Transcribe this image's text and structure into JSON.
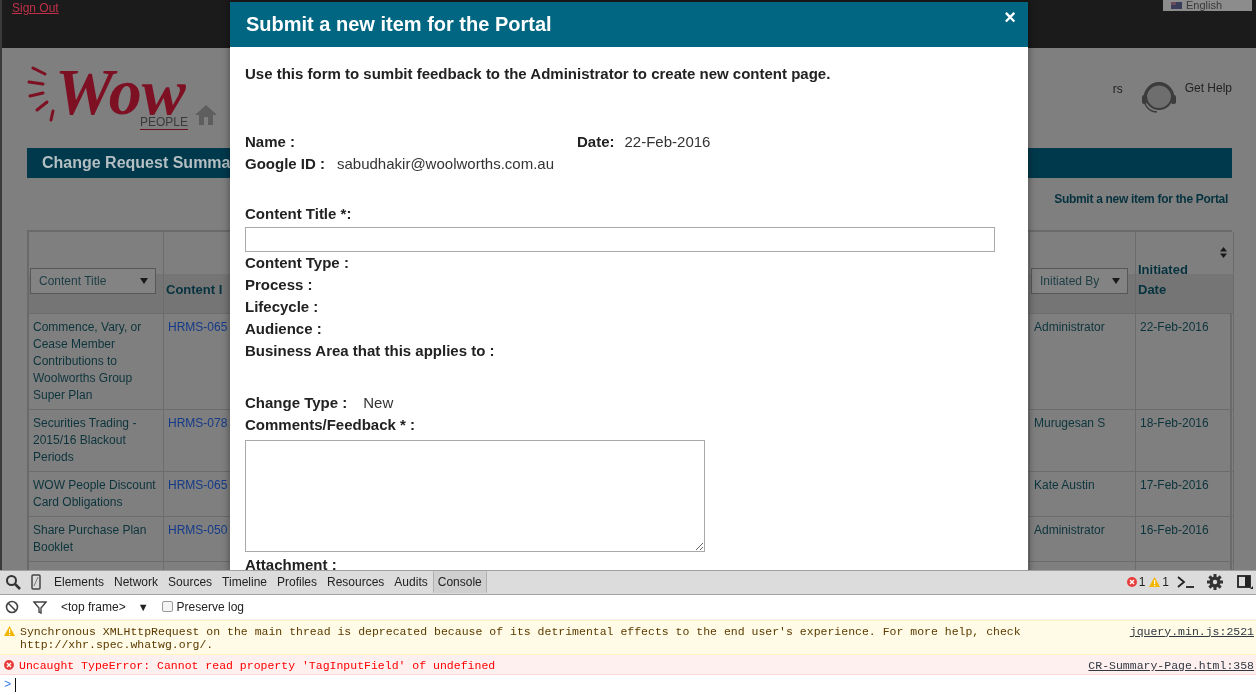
{
  "top_bar": {
    "sign_out": "Sign Out",
    "language": "English"
  },
  "header": {
    "logo_text": "Wow",
    "logo_subtext": "PEOPLE",
    "nav_partial": "rs",
    "help": "Get Help"
  },
  "banner": {
    "title": "Change Request Summa"
  },
  "submit_link": "Submit a new item for the Portal",
  "table": {
    "columns": [
      {
        "kind": "filter",
        "label": "Content Title"
      },
      {
        "kind": "heading",
        "label": "Content I"
      },
      {
        "kind": "filter",
        "label": "Initiated By"
      },
      {
        "kind": "sortable",
        "label": "Initiated Date"
      }
    ],
    "rows": [
      {
        "content_title": "Commence, Vary, or Cease Member Contributions to Woolworths Group Super Plan",
        "content_id": "HRMS-065",
        "initiated_by": "Administrator",
        "initiated_date": "22-Feb-2016"
      },
      {
        "content_title": "Securities Trading - 2015/16 Blackout Periods",
        "content_id": "HRMS-078",
        "initiated_by": "Murugesan S",
        "initiated_date": "18-Feb-2016"
      },
      {
        "content_title": "WOW People Discount Card Obligations",
        "content_id": "HRMS-065",
        "initiated_by": "Kate Austin",
        "initiated_date": "17-Feb-2016"
      },
      {
        "content_title": "Share Purchase Plan Booklet",
        "content_id": "HRMS-050",
        "initiated_by": "Administrator",
        "initiated_date": "16-Feb-2016"
      }
    ]
  },
  "modal": {
    "title": "Submit a new item for the Portal",
    "close": "×",
    "intro": "Use this form to sumbit feedback to the Administrator to create new content page.",
    "name": {
      "label": "Name :"
    },
    "date": {
      "label": "Date:",
      "value": "22-Feb-2016"
    },
    "google_id": {
      "label": "Google ID :",
      "value": "sabudhakir@woolworths.com.au"
    },
    "content_title": {
      "label": "Content Title *:"
    },
    "info_labels": [
      "Content Type :",
      "Process :",
      "Lifecycle :",
      "Audience :",
      "Business Area that this applies to :"
    ],
    "change_type": {
      "label": "Change Type :",
      "value": "New"
    },
    "comments": {
      "label": "Comments/Feedback * :"
    },
    "attachment": {
      "label": "Attachment :"
    }
  },
  "devtools": {
    "tabs": [
      {
        "label": "Elements",
        "selected": false
      },
      {
        "label": "Network",
        "selected": false
      },
      {
        "label": "Sources",
        "selected": false
      },
      {
        "label": "Timeline",
        "selected": false
      },
      {
        "label": "Profiles",
        "selected": false
      },
      {
        "label": "Resources",
        "selected": false
      },
      {
        "label": "Audits",
        "selected": false
      },
      {
        "label": "Console",
        "selected": true
      }
    ],
    "error_count": "1",
    "warning_count": "1",
    "frame_select": "<top frame>",
    "frame_caret": "▼",
    "preserve_log": {
      "label": "Preserve log",
      "checked": false
    },
    "messages": [
      {
        "kind": "warning",
        "text": "Synchronous XMLHttpRequest on the main thread is deprecated because of its detrimental effects to the end user's experience. For more help, check http://xhr.spec.whatwg.org/.",
        "source": "jquery.min.js:2521"
      },
      {
        "kind": "error",
        "text": "Uncaught TypeError: Cannot read property 'TagInputField' of undefined",
        "source": "CR-Summary-Page.html:358"
      }
    ],
    "prompt": ">"
  }
}
